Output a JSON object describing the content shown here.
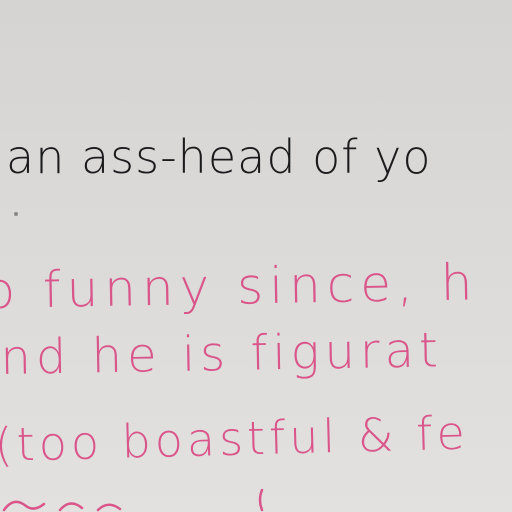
{
  "lines": {
    "line1": "an ass-head of yo",
    "line2": "o funny since, h",
    "line3": "nd he is figurat",
    "line4": "(too boastful & fe"
  },
  "colors": {
    "paper": "#dcdad8",
    "black_ink": "#1b1b1d",
    "pink_ink": "#d9558a"
  }
}
